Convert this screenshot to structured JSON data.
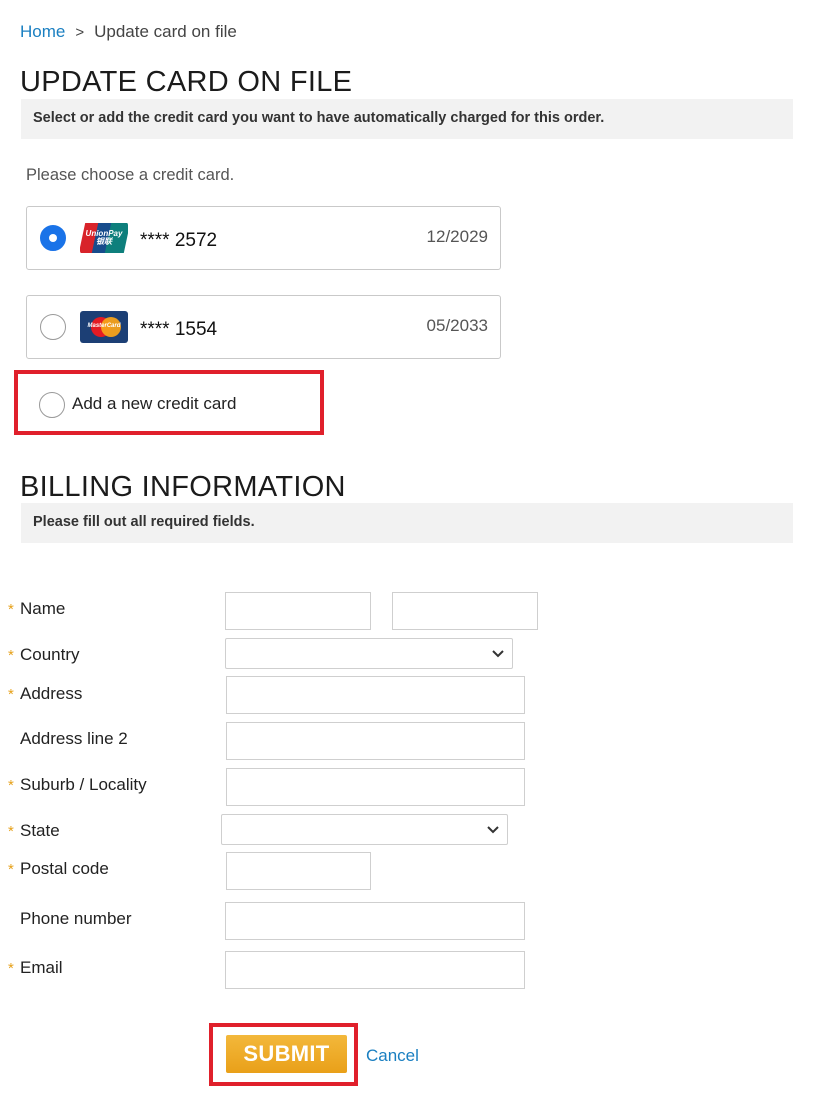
{
  "breadcrumb": {
    "home": "Home",
    "separator": ">",
    "current": "Update card on file"
  },
  "card_section": {
    "title": "UPDATE CARD ON FILE",
    "subtitle": "Select or add the credit card you want to have automatically charged for this order.",
    "choose_label": "Please choose a credit card.",
    "cards": [
      {
        "brand": "unionpay-icon",
        "brand_text": "UnionPay 银联",
        "number": "**** 2572",
        "expiry": "12/2029",
        "selected": true
      },
      {
        "brand": "mastercard-icon",
        "brand_text": "MasterCard",
        "number": "**** 1554",
        "expiry": "05/2033",
        "selected": false
      }
    ],
    "add_new_label": "Add a new credit card"
  },
  "billing_section": {
    "title": "BILLING INFORMATION",
    "subtitle": "Please fill out all required fields.",
    "required_marker": "*",
    "fields": {
      "name": {
        "label": "Name",
        "required": true
      },
      "country": {
        "label": "Country",
        "required": true,
        "selected": ""
      },
      "address": {
        "label": "Address",
        "required": true
      },
      "address2": {
        "label": "Address line 2",
        "required": false
      },
      "suburb": {
        "label": "Suburb / Locality",
        "required": true
      },
      "state": {
        "label": "State",
        "required": true,
        "selected": ""
      },
      "postal": {
        "label": "Postal code",
        "required": true
      },
      "phone": {
        "label": "Phone number",
        "required": false
      },
      "email": {
        "label": "Email",
        "required": true
      }
    }
  },
  "actions": {
    "submit": "SUBMIT",
    "cancel": "Cancel"
  },
  "colors": {
    "link": "#1a7fc1",
    "accent_button": "#eba61f",
    "required_star": "#e6a11a",
    "highlight_frame": "#e0202b",
    "radio_selected": "#1a73e8"
  }
}
